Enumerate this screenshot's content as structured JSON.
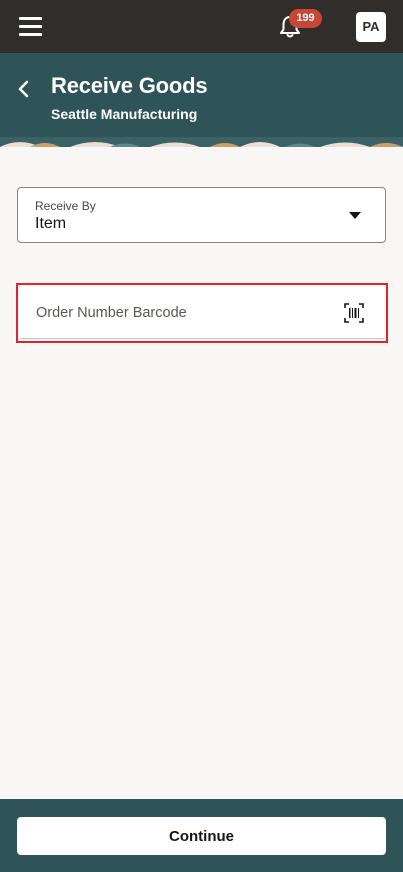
{
  "topbar": {
    "notifications_count": "199",
    "avatar_initials": "PA"
  },
  "header": {
    "title": "Receive Goods",
    "subtitle": "Seattle Manufacturing"
  },
  "receive_by": {
    "label": "Receive By",
    "value": "Item"
  },
  "order_barcode": {
    "placeholder": "Order Number Barcode",
    "value": ""
  },
  "footer": {
    "continue_label": "Continue"
  },
  "colors": {
    "topbar": "#312d2a",
    "header": "#2f5458",
    "badge": "#c74634",
    "highlight": "#d9262f"
  }
}
